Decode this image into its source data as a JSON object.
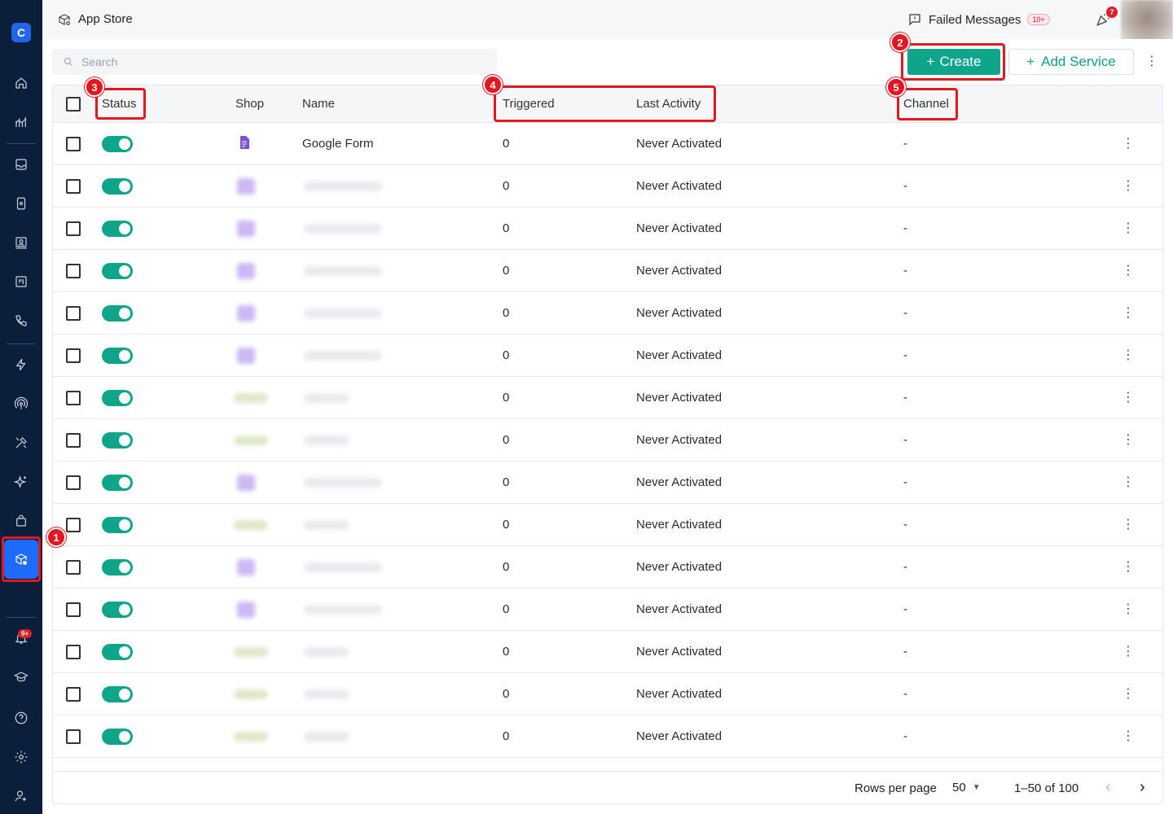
{
  "app": {
    "title": "App Store"
  },
  "header": {
    "failed_messages": "Failed Messages",
    "failed_badge": "10+",
    "notification_badge": "7"
  },
  "sidebar": {
    "logo": "C",
    "notifications_badge": "9+"
  },
  "search": {
    "placeholder": "Search"
  },
  "toolbar": {
    "create_label": "Create",
    "add_service_label": "Add Service"
  },
  "table": {
    "columns": {
      "status": "Status",
      "shop": "Shop",
      "name": "Name",
      "triggered": "Triggered",
      "last_activity": "Last Activity",
      "channel": "Channel"
    },
    "rows": [
      {
        "name": "Google Form",
        "triggered": "0",
        "last_activity": "Never Activated",
        "channel": "-"
      },
      {
        "name": "",
        "triggered": "0",
        "last_activity": "Never Activated",
        "channel": "-"
      },
      {
        "name": "",
        "triggered": "0",
        "last_activity": "Never Activated",
        "channel": "-"
      },
      {
        "name": "",
        "triggered": "0",
        "last_activity": "Never Activated",
        "channel": "-"
      },
      {
        "name": "",
        "triggered": "0",
        "last_activity": "Never Activated",
        "channel": "-"
      },
      {
        "name": "",
        "triggered": "0",
        "last_activity": "Never Activated",
        "channel": "-"
      },
      {
        "name": "",
        "triggered": "0",
        "last_activity": "Never Activated",
        "channel": "-"
      },
      {
        "name": "",
        "triggered": "0",
        "last_activity": "Never Activated",
        "channel": "-"
      },
      {
        "name": "",
        "triggered": "0",
        "last_activity": "Never Activated",
        "channel": "-"
      },
      {
        "name": "",
        "triggered": "0",
        "last_activity": "Never Activated",
        "channel": "-"
      },
      {
        "name": "",
        "triggered": "0",
        "last_activity": "Never Activated",
        "channel": "-"
      },
      {
        "name": "",
        "triggered": "0",
        "last_activity": "Never Activated",
        "channel": "-"
      },
      {
        "name": "",
        "triggered": "0",
        "last_activity": "Never Activated",
        "channel": "-"
      },
      {
        "name": "",
        "triggered": "0",
        "last_activity": "Never Activated",
        "channel": "-"
      },
      {
        "name": "",
        "triggered": "0",
        "last_activity": "Never Activated",
        "channel": "-"
      }
    ]
  },
  "pagination": {
    "rows_per_page_label": "Rows per page",
    "rows_per_page_value": "50",
    "range": "1–50 of 100"
  },
  "annotations": [
    "1",
    "2",
    "3",
    "4",
    "5"
  ],
  "colors": {
    "accent": "#0ea58a",
    "sidebar": "#0b1f3a",
    "annotation": "#e5161f",
    "active_nav": "#1d6bff"
  }
}
